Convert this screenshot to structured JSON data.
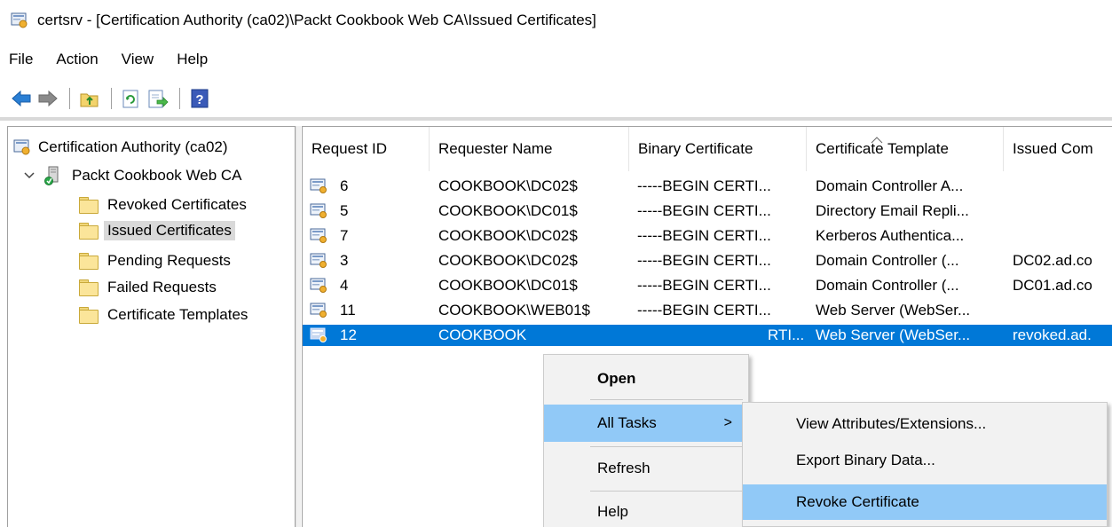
{
  "window": {
    "title": "certsrv - [Certification Authority (ca02)\\Packt Cookbook Web CA\\Issued Certificates]"
  },
  "menubar": {
    "items": [
      "File",
      "Action",
      "View",
      "Help"
    ]
  },
  "toolbar": {
    "buttons": [
      "back-arrow-icon",
      "forward-arrow-icon",
      "up-folder-icon",
      "refresh-icon",
      "export-list-icon",
      "help-icon"
    ]
  },
  "tree": {
    "root": "Certification Authority (ca02)",
    "ca": "Packt Cookbook Web CA",
    "folders": [
      "Revoked Certificates",
      "Issued Certificates",
      "Pending Requests",
      "Failed Requests",
      "Certificate Templates"
    ],
    "selected": "Issued Certificates"
  },
  "list": {
    "columns": [
      "Request ID",
      "Requester Name",
      "Binary Certificate",
      "Certificate Template",
      "Issued Com"
    ],
    "rows": [
      {
        "id": "6",
        "requester": "COOKBOOK\\DC02$",
        "binary": "-----BEGIN CERTI...",
        "template": "Domain Controller A...",
        "issued": ""
      },
      {
        "id": "5",
        "requester": "COOKBOOK\\DC01$",
        "binary": "-----BEGIN CERTI...",
        "template": "Directory Email Repli...",
        "issued": ""
      },
      {
        "id": "7",
        "requester": "COOKBOOK\\DC02$",
        "binary": "-----BEGIN CERTI...",
        "template": "Kerberos Authentica...",
        "issued": ""
      },
      {
        "id": "3",
        "requester": "COOKBOOK\\DC02$",
        "binary": "-----BEGIN CERTI...",
        "template": "Domain Controller (...",
        "issued": "DC02.ad.co"
      },
      {
        "id": "4",
        "requester": "COOKBOOK\\DC01$",
        "binary": "-----BEGIN CERTI...",
        "template": "Domain Controller (...",
        "issued": "DC01.ad.co"
      },
      {
        "id": "11",
        "requester": "COOKBOOK\\WEB01$",
        "binary": "-----BEGIN CERTI...",
        "template": "Web Server (WebSer...",
        "issued": ""
      },
      {
        "id": "12",
        "requester": "COOKBOOK",
        "binary": "RTI...",
        "template": "Web Server (WebSer...",
        "issued": "revoked.ad."
      }
    ],
    "selected_row": "12"
  },
  "context_menu": {
    "open": "Open",
    "all_tasks": "All Tasks",
    "all_tasks_arrow": ">",
    "refresh": "Refresh",
    "help": "Help"
  },
  "submenu": {
    "items": [
      "View Attributes/Extensions...",
      "Export Binary Data...",
      "Revoke Certificate"
    ],
    "highlighted": "Revoke Certificate"
  },
  "colors": {
    "selection": "#0078d7",
    "menu_highlight": "#91c9f7",
    "tree_selection": "#d9d9d9"
  }
}
